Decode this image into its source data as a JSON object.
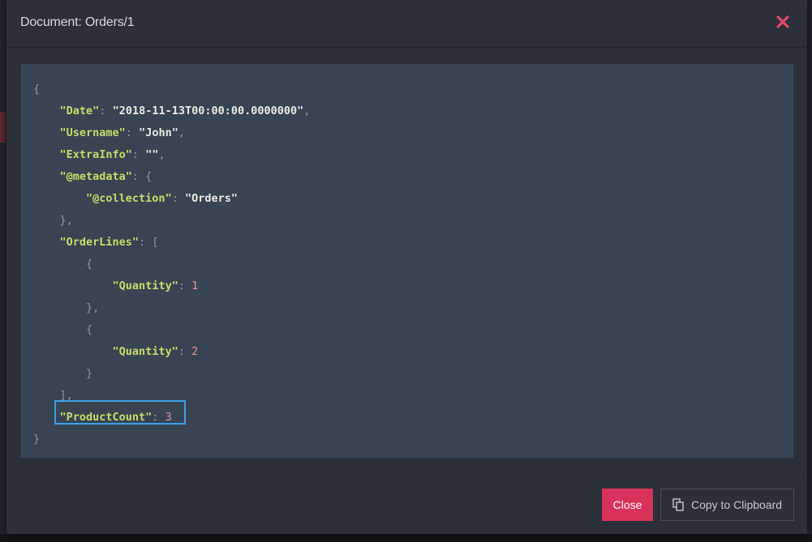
{
  "modal": {
    "title": "Document: Orders/1",
    "close_icon": "close-icon",
    "accent_color": "#e0466a"
  },
  "document": {
    "lines": [
      {
        "indent": 0,
        "parts": [
          {
            "t": "p",
            "v": "{"
          }
        ]
      },
      {
        "indent": 1,
        "parts": [
          {
            "t": "k",
            "v": "\"Date\""
          },
          {
            "t": "p",
            "v": ": "
          },
          {
            "t": "s",
            "v": "\"2018-11-13T00:00:00.0000000\""
          },
          {
            "t": "p",
            "v": ","
          }
        ]
      },
      {
        "indent": 1,
        "parts": [
          {
            "t": "k",
            "v": "\"Username\""
          },
          {
            "t": "p",
            "v": ": "
          },
          {
            "t": "s",
            "v": "\"John\""
          },
          {
            "t": "p",
            "v": ","
          }
        ]
      },
      {
        "indent": 1,
        "parts": [
          {
            "t": "k",
            "v": "\"ExtraInfo\""
          },
          {
            "t": "p",
            "v": ": "
          },
          {
            "t": "s",
            "v": "\"\""
          },
          {
            "t": "p",
            "v": ","
          }
        ]
      },
      {
        "indent": 1,
        "parts": [
          {
            "t": "k",
            "v": "\"@metadata\""
          },
          {
            "t": "p",
            "v": ": {"
          }
        ]
      },
      {
        "indent": 2,
        "parts": [
          {
            "t": "k",
            "v": "\"@collection\""
          },
          {
            "t": "p",
            "v": ": "
          },
          {
            "t": "s",
            "v": "\"Orders\""
          }
        ]
      },
      {
        "indent": 1,
        "parts": [
          {
            "t": "p",
            "v": "},"
          }
        ]
      },
      {
        "indent": 1,
        "parts": [
          {
            "t": "k",
            "v": "\"OrderLines\""
          },
          {
            "t": "p",
            "v": ": ["
          }
        ]
      },
      {
        "indent": 2,
        "parts": [
          {
            "t": "p",
            "v": "{"
          }
        ]
      },
      {
        "indent": 3,
        "parts": [
          {
            "t": "k",
            "v": "\"Quantity\""
          },
          {
            "t": "p",
            "v": ": "
          },
          {
            "t": "n",
            "v": "1"
          }
        ]
      },
      {
        "indent": 2,
        "parts": [
          {
            "t": "p",
            "v": "},"
          }
        ]
      },
      {
        "indent": 2,
        "parts": [
          {
            "t": "p",
            "v": "{"
          }
        ]
      },
      {
        "indent": 3,
        "parts": [
          {
            "t": "k",
            "v": "\"Quantity\""
          },
          {
            "t": "p",
            "v": ": "
          },
          {
            "t": "n",
            "v": "2"
          }
        ]
      },
      {
        "indent": 2,
        "parts": [
          {
            "t": "p",
            "v": "}"
          }
        ]
      },
      {
        "indent": 1,
        "parts": [
          {
            "t": "p",
            "v": "],"
          }
        ]
      },
      {
        "indent": 1,
        "parts": [
          {
            "t": "k",
            "v": "\"ProductCount\""
          },
          {
            "t": "p",
            "v": ": "
          },
          {
            "t": "n",
            "v": "3"
          }
        ]
      },
      {
        "indent": 0,
        "parts": [
          {
            "t": "p",
            "v": "}"
          }
        ]
      }
    ],
    "highlighted_line": 15,
    "highlight_color": "#3fa0e8"
  },
  "footer": {
    "close_label": "Close",
    "copy_label": "Copy to Clipboard",
    "copy_icon": "copy-icon",
    "close_button_color": "#d9325a"
  }
}
